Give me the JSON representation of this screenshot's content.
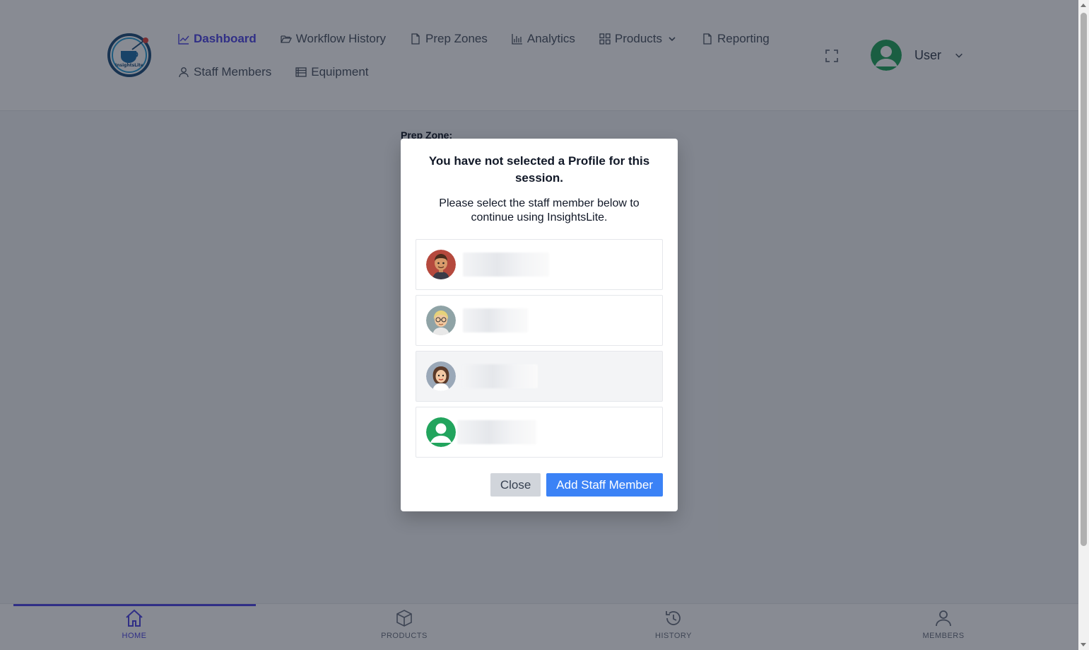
{
  "brand": {
    "logo_text": "InsightsLite"
  },
  "nav": {
    "row1": [
      {
        "label": "Dashboard",
        "icon": "chart-line-icon",
        "active": true
      },
      {
        "label": "Workflow History",
        "icon": "folder-open-icon"
      },
      {
        "label": "Prep Zones",
        "icon": "document-icon"
      },
      {
        "label": "Analytics",
        "icon": "bar-chart-icon"
      },
      {
        "label": "Products",
        "icon": "grid-icon",
        "dropdown": true
      },
      {
        "label": "Reporting",
        "icon": "document-icon"
      }
    ],
    "row2": [
      {
        "label": "Staff Members",
        "icon": "user-icon"
      },
      {
        "label": "Equipment",
        "icon": "list-icon"
      }
    ]
  },
  "user": {
    "name": "User"
  },
  "content": {
    "prep_zone_label": "Prep Zone:"
  },
  "modal": {
    "title": "You have not selected a Profile for this session.",
    "subtitle": "Please select the staff member below to continue using InsightsLite.",
    "staff": [
      {
        "avatar": "male-avatar-icon",
        "name_redacted": true
      },
      {
        "avatar": "elderly-woman-avatar-icon",
        "name_redacted": true
      },
      {
        "avatar": "woman-avatar-icon",
        "name_redacted": true
      },
      {
        "avatar": "default-user-avatar-icon",
        "name_redacted": true
      }
    ],
    "close_label": "Close",
    "add_label": "Add Staff Member"
  },
  "bottom_nav": [
    {
      "label": "HOME",
      "icon": "home-icon",
      "active": true
    },
    {
      "label": "PRODUCTS",
      "icon": "box-icon"
    },
    {
      "label": "HISTORY",
      "icon": "history-icon"
    },
    {
      "label": "MEMBERS",
      "icon": "user-icon"
    }
  ],
  "colors": {
    "accent": "#4f46e5",
    "primary_button": "#3b82f6",
    "avatar_green": "#22a45d"
  }
}
